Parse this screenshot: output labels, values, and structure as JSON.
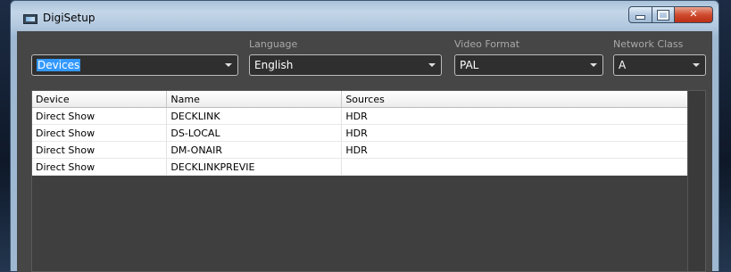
{
  "window": {
    "title": "DigiSetup"
  },
  "controls": {
    "device_combo": {
      "value": "Devices"
    },
    "language": {
      "label": "Language",
      "value": "English"
    },
    "video_format": {
      "label": "Video Format",
      "value": "PAL"
    },
    "network_class": {
      "label": "Network Class",
      "value": "A"
    }
  },
  "grid": {
    "columns": [
      "Device",
      "Name",
      "Sources"
    ],
    "rows": [
      [
        "Direct Show",
        "DECKLINK",
        "HDR"
      ],
      [
        "Direct Show",
        "DS-LOCAL",
        "HDR"
      ],
      [
        "Direct Show",
        "DM-ONAIR",
        "HDR"
      ],
      [
        "Direct Show",
        "DECKLINKPREVIE",
        ""
      ]
    ]
  },
  "icons": {
    "app": "digisetup-app-icon",
    "minimize": "minimize-icon",
    "maximize": "maximize-icon",
    "close": "close-icon",
    "dropdown": "chevron-down-icon"
  },
  "colors": {
    "client_background": "#464646",
    "selection": "#3399ff",
    "close_button": "#cf4b2f"
  }
}
